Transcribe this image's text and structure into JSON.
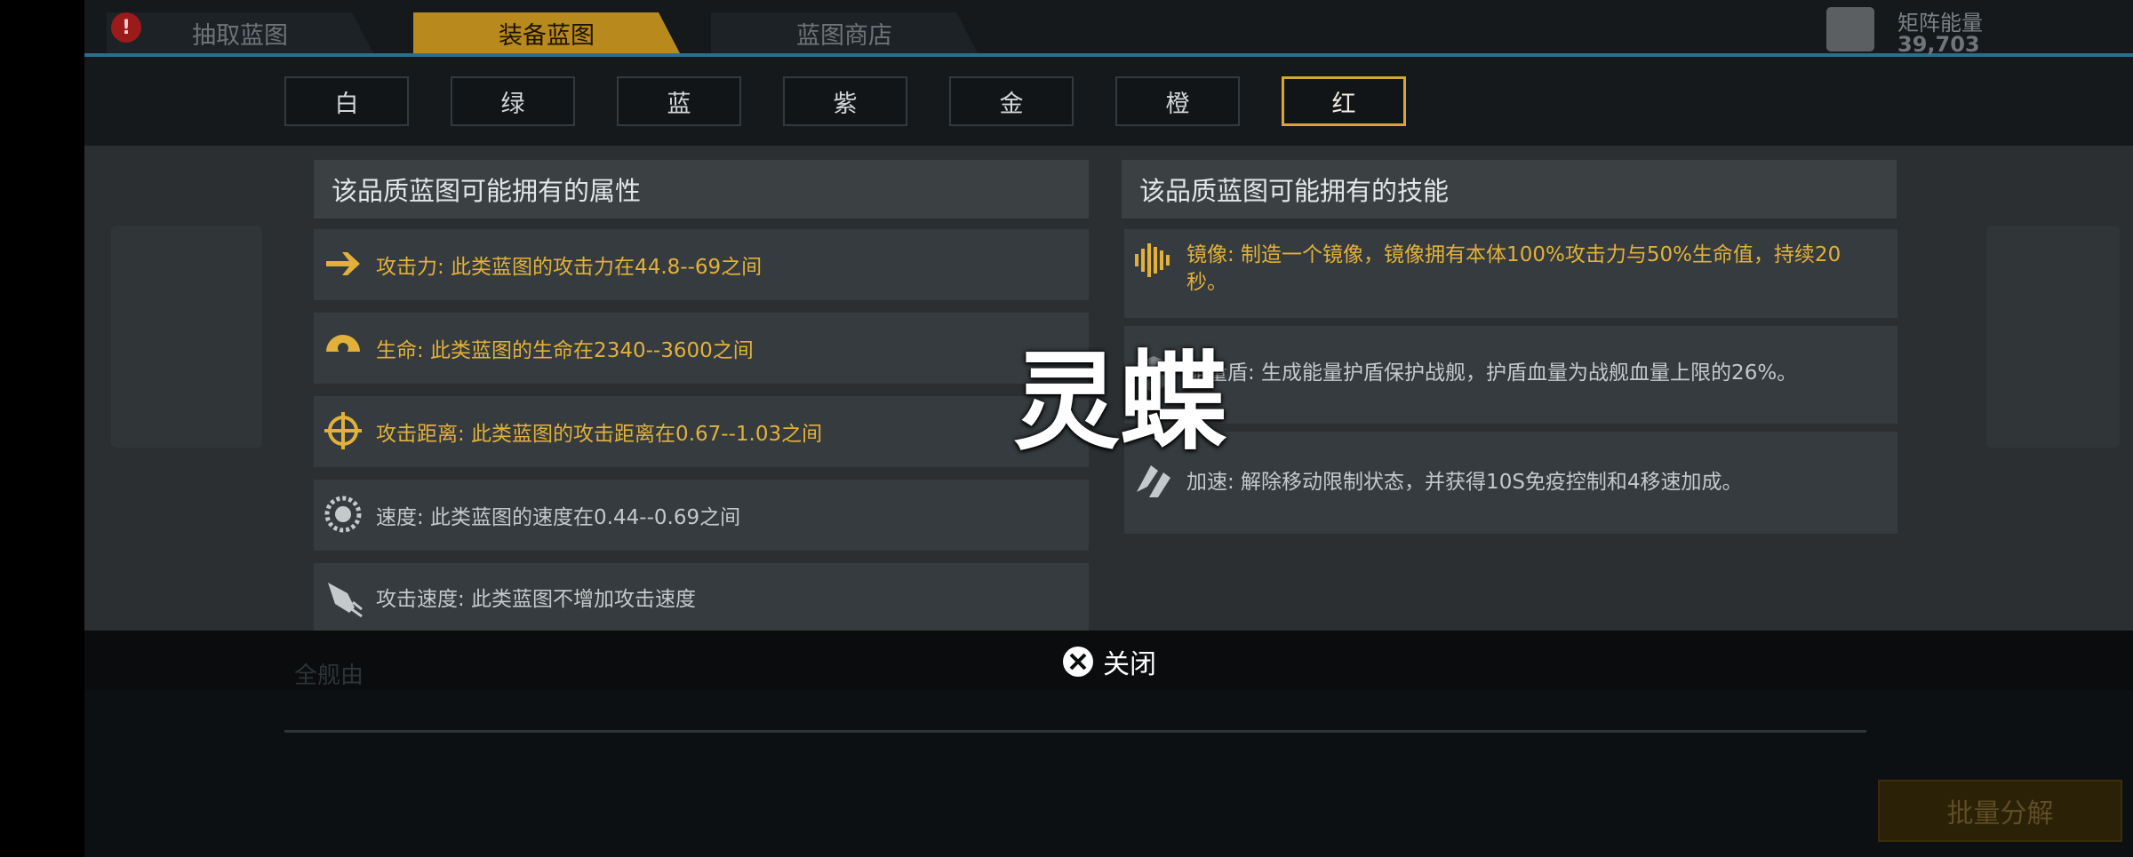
{
  "top_tabs": [
    {
      "label": "抽取蓝图",
      "active": false,
      "has_alert_badge": true
    },
    {
      "label": "装备蓝图",
      "active": true
    },
    {
      "label": "蓝图商店",
      "active": false
    }
  ],
  "alert_badge": "!",
  "energy": {
    "label": "矩阵能量",
    "value": "39,703",
    "icon": "matrix-cube-icon"
  },
  "quality_filters": [
    {
      "label": "白",
      "active": false
    },
    {
      "label": "绿",
      "active": false
    },
    {
      "label": "蓝",
      "active": false
    },
    {
      "label": "紫",
      "active": false
    },
    {
      "label": "金",
      "active": false
    },
    {
      "label": "橙",
      "active": false
    },
    {
      "label": "红",
      "active": true
    }
  ],
  "attributes": {
    "title": "该品质蓝图可能拥有的属性",
    "items": [
      {
        "icon": "attack-arrow-icon",
        "text": "攻击力: 此类蓝图的攻击力在44.8--69之间",
        "highlight": true
      },
      {
        "icon": "life-shield-icon",
        "text": "生命: 此类蓝图的生命在2340--3600之间",
        "highlight": true
      },
      {
        "icon": "crosshair-icon",
        "text": "攻击距离: 此类蓝图的攻击距离在0.67--1.03之间",
        "highlight": true
      },
      {
        "icon": "speed-gear-icon",
        "text": "速度: 此类蓝图的速度在0.44--0.69之间",
        "highlight": false
      },
      {
        "icon": "rocket-icon",
        "text": "攻击速度: 此类蓝图不增加攻击速度",
        "highlight": false
      }
    ]
  },
  "skills": {
    "title": "该品质蓝图可能拥有的技能",
    "items": [
      {
        "icon": "mirror-wave-icon",
        "text": "镜像: 制造一个镜像，镜像拥有本体100%攻击力与50%生命值，持续20秒。",
        "highlight": true
      },
      {
        "icon": "energy-shield-icon",
        "text": "能量盾: 生成能量护盾保护战舰，护盾血量为战舰血量上限的26%。",
        "highlight": false
      },
      {
        "icon": "boost-icon",
        "text": "加速: 解除移动限制状态，并获得10S免疫控制和4移速加成。",
        "highlight": false
      }
    ]
  },
  "overlay_title": "灵蝶",
  "close": {
    "label": "关闭",
    "icon": "close-x-icon"
  },
  "bottom_tabs": [
    "全舰由"
  ],
  "batch_button": "批量分解",
  "colors": {
    "gold": "#e3b13a",
    "active_tab": "#b8891c",
    "accent_line": "#2a6f90"
  }
}
